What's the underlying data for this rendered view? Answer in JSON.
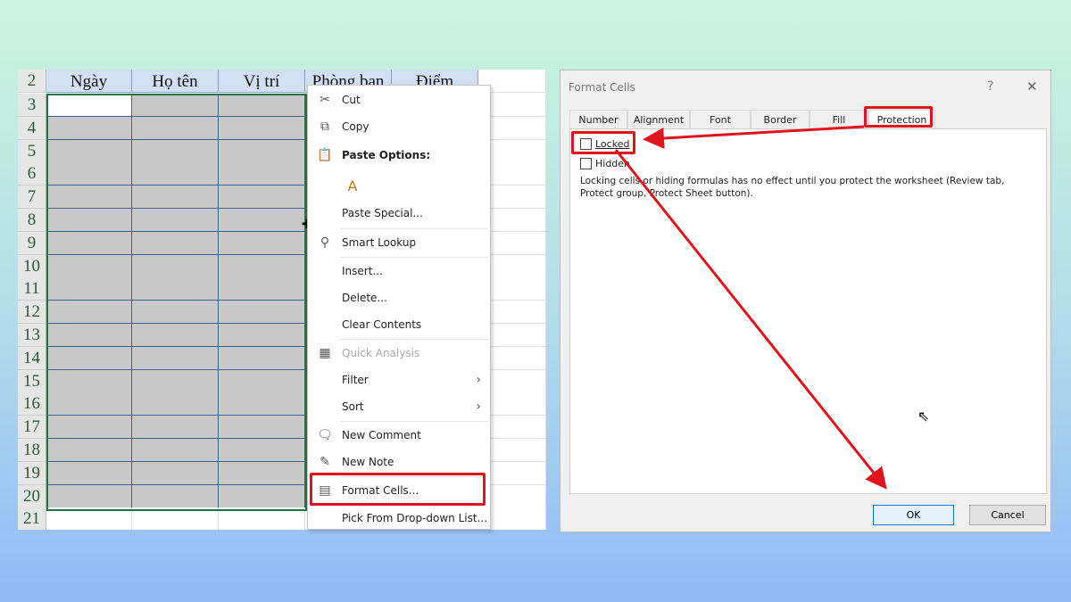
{
  "sheet": {
    "headers": [
      "Ngày",
      "Họ tên",
      "Vị trí",
      "Phòng ban",
      "Điểm"
    ],
    "header_row": "2",
    "rows": [
      "3",
      "4",
      "5",
      "6",
      "7",
      "8",
      "9",
      "10",
      "11",
      "12",
      "13",
      "14",
      "15",
      "16",
      "17",
      "18",
      "19",
      "20",
      "21"
    ]
  },
  "menu": {
    "items": [
      {
        "label": "Cut",
        "icon": "scissors-icon"
      },
      {
        "label": "Copy",
        "icon": "copy-icon"
      },
      {
        "label": "Paste Options:",
        "icon": "paste-icon"
      },
      {
        "label": "",
        "icon": "paste-text-icon"
      },
      {
        "label": "Paste Special..."
      },
      {
        "label": "Smart Lookup",
        "icon": "search-icon"
      },
      {
        "label": "Insert..."
      },
      {
        "label": "Delete..."
      },
      {
        "label": "Clear Contents"
      },
      {
        "label": "Quick Analysis",
        "icon": "quick-analysis-icon",
        "disabled": true
      },
      {
        "label": "Filter",
        "submenu": true
      },
      {
        "label": "Sort",
        "submenu": true
      },
      {
        "label": "New Comment",
        "icon": "comment-icon"
      },
      {
        "label": "New Note",
        "icon": "note-icon"
      },
      {
        "label": "Format Cells...",
        "icon": "format-cells-icon"
      },
      {
        "label": "Pick From Drop-down List..."
      }
    ]
  },
  "dialog": {
    "title": "Format Cells",
    "help": "?",
    "close": "✕",
    "tabs": [
      "Number",
      "Alignment",
      "Font",
      "Border",
      "Fill",
      "Protection"
    ],
    "active_tab": "Protection",
    "locked_label": "Locked",
    "locked_checked": false,
    "hidden_label": "Hidden",
    "hidden_checked": false,
    "note": "Locking cells or hiding formulas has no effect until you protect the worksheet (Review tab, Protect group, Protect Sheet button).",
    "ok": "OK",
    "cancel": "Cancel"
  },
  "colors": {
    "annotation": "#e0141e",
    "selection": "#c8c8c8",
    "header": "#d3e0f3"
  }
}
